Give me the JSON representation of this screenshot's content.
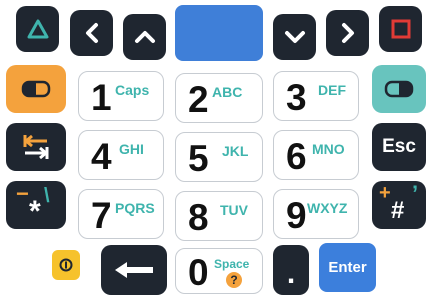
{
  "keypad": {
    "keys": {
      "k1": {
        "digit": "1",
        "letters": "Caps"
      },
      "k2": {
        "digit": "2",
        "letters": "ABC"
      },
      "k3": {
        "digit": "3",
        "letters": "DEF"
      },
      "k4": {
        "digit": "4",
        "letters": "GHI"
      },
      "k5": {
        "digit": "5",
        "letters": "JKL"
      },
      "k6": {
        "digit": "6",
        "letters": "MNO"
      },
      "k7": {
        "digit": "7",
        "letters": "PQRS"
      },
      "k8": {
        "digit": "8",
        "letters": "TUV"
      },
      "k9": {
        "digit": "9",
        "letters": "WXYZ"
      },
      "k0": {
        "digit": "0",
        "letters": "Space",
        "sub": "?"
      }
    },
    "esc_label": "Esc",
    "enter_label": "Enter",
    "dot_label": ".",
    "star_symbols": {
      "main": "*",
      "alt_orange": "−",
      "alt_teal": "\\"
    },
    "hash_symbols": {
      "main": "#",
      "alt_orange": "+",
      "alt_teal": "’"
    },
    "colors": {
      "key_dark": "#1f2630",
      "accent_teal": "#3fb4ad",
      "accent_orange": "#f4a23d",
      "center_blue": "#3f7fd8",
      "enter_blue": "#3c7fdc",
      "power_yellow": "#f6c22c",
      "red_square": "#e03b36",
      "green_triangle": "#3fb4ad"
    },
    "icons": [
      "triangle-icon",
      "chevron-left-icon",
      "chevron-up-icon",
      "chevron-down-icon",
      "chevron-right-icon",
      "square-icon",
      "left-function-icon",
      "right-function-icon",
      "tab-icon",
      "power-icon",
      "backspace-arrow-icon"
    ]
  }
}
